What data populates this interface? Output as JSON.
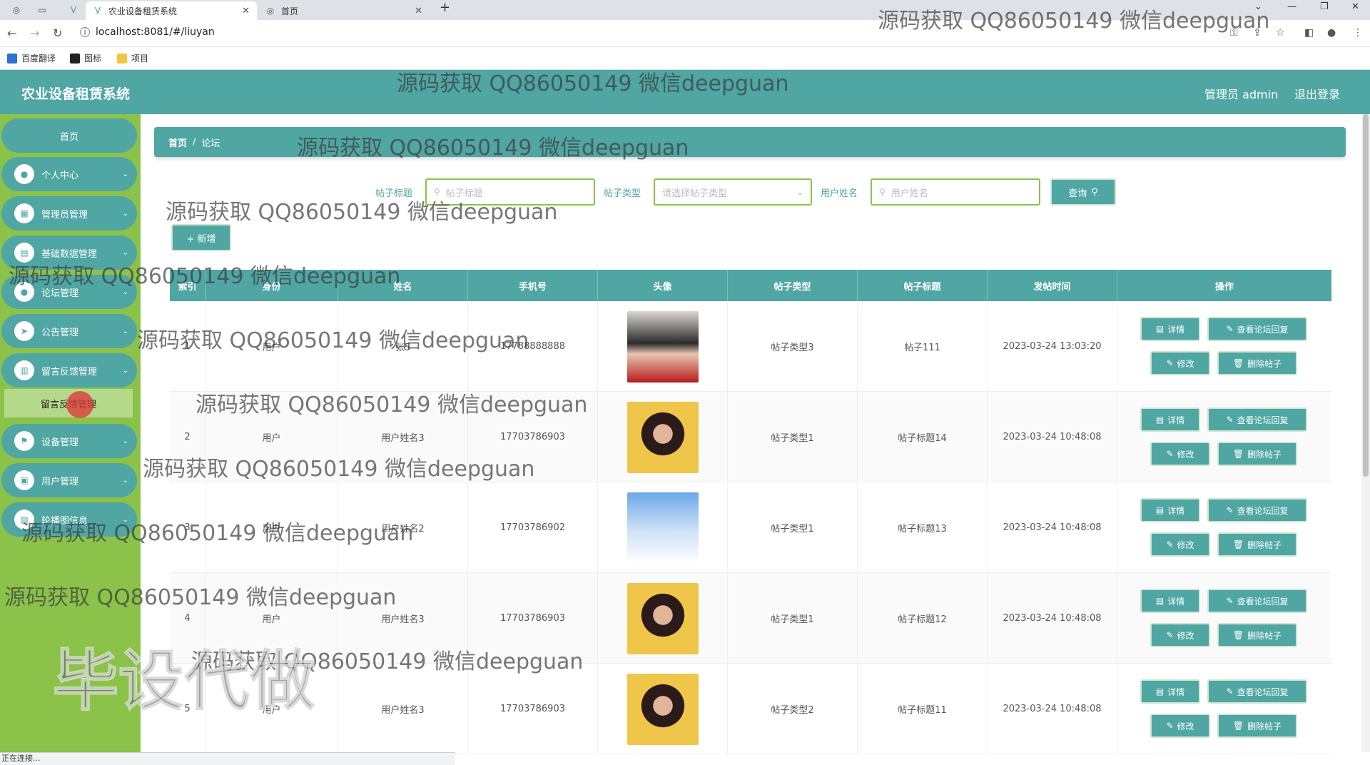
{
  "browser": {
    "tabs": [
      {
        "title": "农业设备租赁系统"
      },
      {
        "title": "首页"
      }
    ],
    "url": "localhost:8081/#/liuyan",
    "bookmarks": [
      "百度翻译",
      "图标",
      "项目"
    ],
    "status": "正在连接..."
  },
  "header": {
    "title": "农业设备租赁系统",
    "user": "管理员 admin",
    "logout": "退出登录"
  },
  "sidebar": {
    "items": [
      {
        "label": "首页",
        "icon": "home-icon"
      },
      {
        "label": "个人中心",
        "icon": "user-icon"
      },
      {
        "label": "管理员管理",
        "icon": "grid-icon"
      },
      {
        "label": "基础数据管理",
        "icon": "chart-icon"
      },
      {
        "label": "论坛管理",
        "icon": "user-icon"
      },
      {
        "label": "公告管理",
        "icon": "send-icon"
      },
      {
        "label": "留言反馈管理",
        "icon": "book-icon"
      },
      {
        "label": "设备管理",
        "icon": "flag-icon"
      },
      {
        "label": "用户管理",
        "icon": "briefcase-icon"
      },
      {
        "label": "轮播图信息",
        "icon": "image-icon"
      }
    ],
    "sub_active": "留言反馈管理"
  },
  "breadcrumb": {
    "home": "首页",
    "current": "论坛"
  },
  "filters": {
    "title_label": "帖子标题",
    "title_placeholder": "帖子标题",
    "type_label": "帖子类型",
    "type_placeholder": "请选择帖子类型",
    "name_label": "用户姓名",
    "name_placeholder": "用户姓名",
    "query": "查询",
    "add": "+ 新增"
  },
  "table": {
    "columns": [
      "索引",
      "身份",
      "姓名",
      "手机号",
      "头像",
      "帖子类型",
      "帖子标题",
      "发帖时间",
      "操作"
    ],
    "rows": [
      {
        "index": "1",
        "role": "用户",
        "name": "张5",
        "phone": "17788888888",
        "type": "帖子类型3",
        "title": "帖子111",
        "time": "2023-03-24 13:03:20"
      },
      {
        "index": "2",
        "role": "用户",
        "name": "用户姓名3",
        "phone": "17703786903",
        "type": "帖子类型1",
        "title": "帖子标题14",
        "time": "2023-03-24 10:48:08"
      },
      {
        "index": "3",
        "role": "用户",
        "name": "用户姓名2",
        "phone": "17703786902",
        "type": "帖子类型1",
        "title": "帖子标题13",
        "time": "2023-03-24 10:48:08"
      },
      {
        "index": "4",
        "role": "用户",
        "name": "用户姓名3",
        "phone": "17703786903",
        "type": "帖子类型1",
        "title": "帖子标题12",
        "time": "2023-03-24 10:48:08"
      },
      {
        "index": "5",
        "role": "用户",
        "name": "用户姓名3",
        "phone": "17703786903",
        "type": "帖子类型2",
        "title": "帖子标题11",
        "time": "2023-03-24 10:48:08"
      }
    ],
    "actions": {
      "detail": "详情",
      "reply": "查看论坛回复",
      "edit": "修改",
      "delete": "删除帖子"
    }
  },
  "watermark": {
    "text": "源码获取 QQ86050149 微信deepguan",
    "big": "毕设代做"
  }
}
